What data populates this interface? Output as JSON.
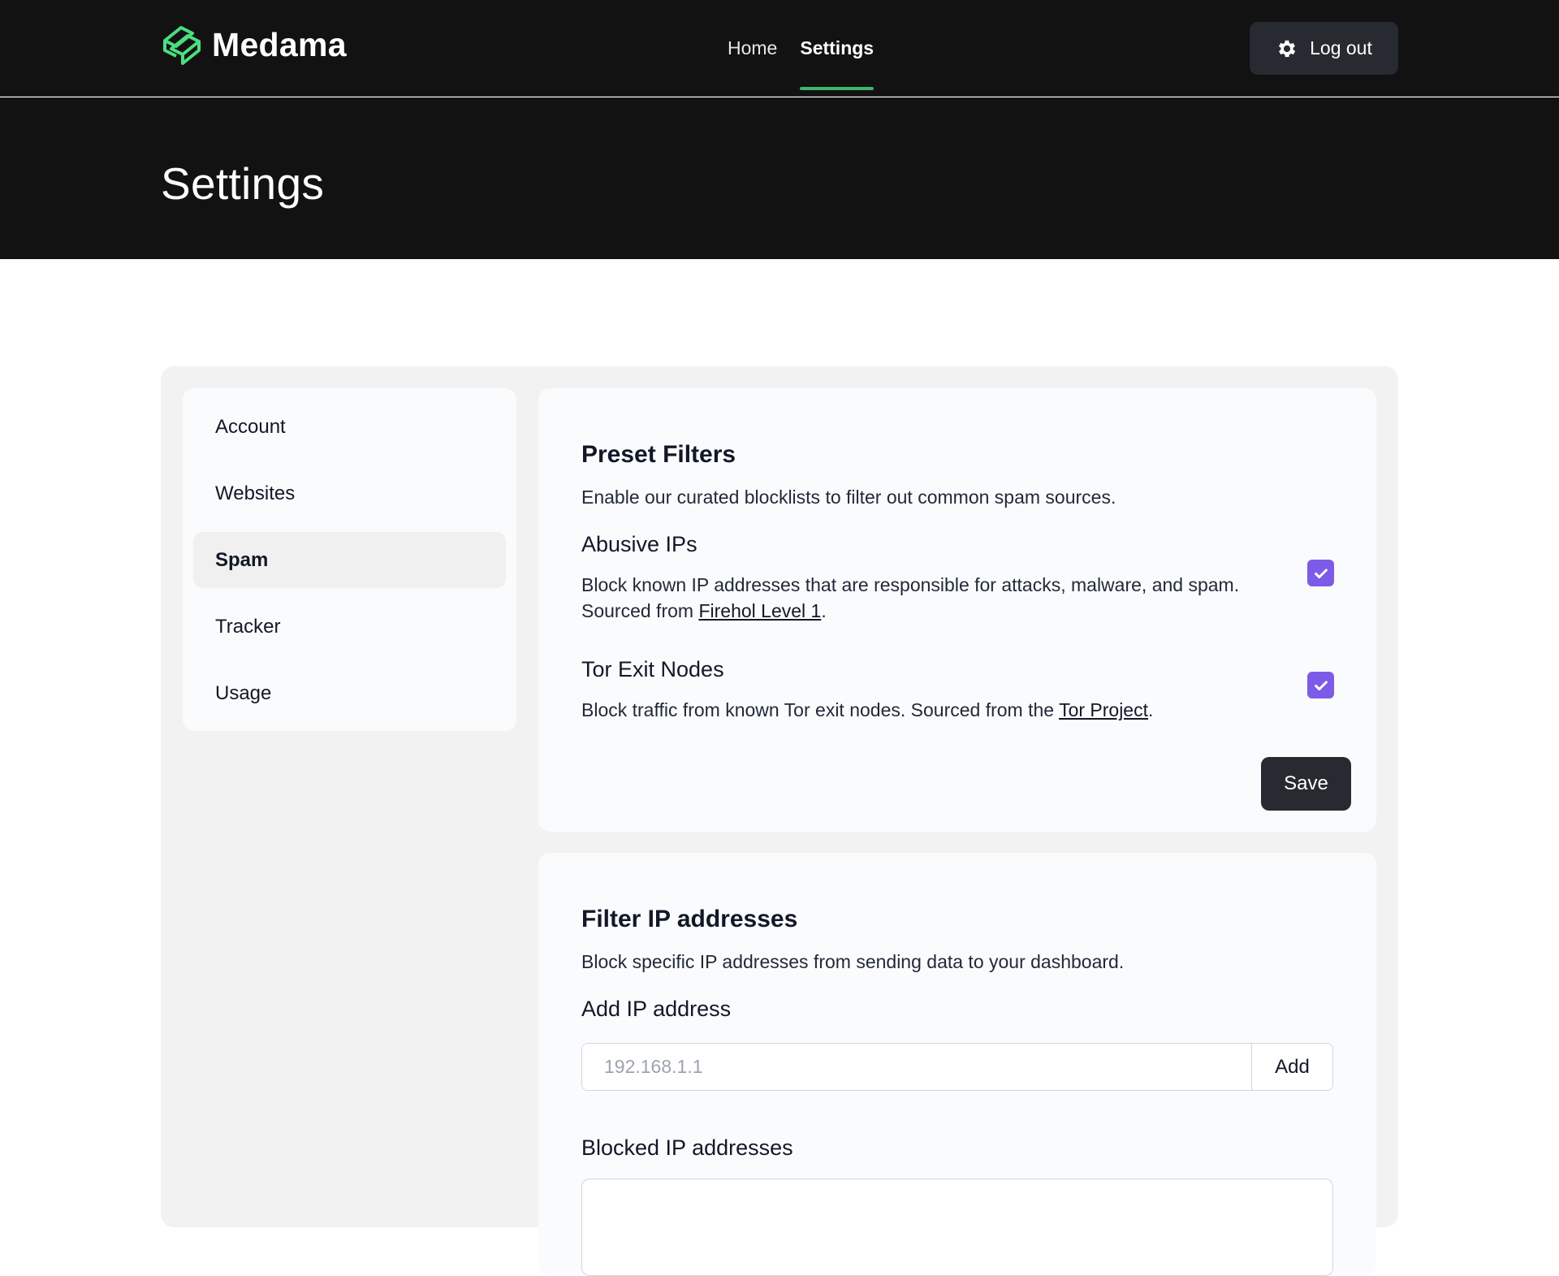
{
  "app": {
    "name": "Medama",
    "accent_color": "#4ade80",
    "checkbox_color": "#7c5ce7"
  },
  "nav": {
    "items": [
      {
        "label": "Home",
        "active": false
      },
      {
        "label": "Settings",
        "active": true
      }
    ],
    "logout": {
      "label": "Log out",
      "icon": "gear-icon"
    }
  },
  "header": {
    "title": "Settings"
  },
  "sidebar": {
    "items": [
      {
        "label": "Account",
        "active": false
      },
      {
        "label": "Websites",
        "active": false
      },
      {
        "label": "Spam",
        "active": true
      },
      {
        "label": "Tracker",
        "active": false
      },
      {
        "label": "Usage",
        "active": false
      }
    ]
  },
  "preset_filters": {
    "title": "Preset Filters",
    "description": "Enable our curated blocklists to filter out common spam sources.",
    "abusive_ips": {
      "title": "Abusive IPs",
      "description_line1": "Block known IP addresses that are responsible for attacks, malware, and spam.",
      "description_prefix": "Sourced from ",
      "link": "Firehol Level 1",
      "description_suffix": ".",
      "checked": true
    },
    "tor_exit_nodes": {
      "title": "Tor Exit Nodes",
      "description_prefix": "Block traffic from known Tor exit nodes. Sourced from the ",
      "link": "Tor Project",
      "description_suffix": ".",
      "checked": true
    },
    "save_label": "Save"
  },
  "filter_ips": {
    "title": "Filter IP addresses",
    "description": "Block specific IP addresses from sending data to your dashboard.",
    "add_label": "Add IP address",
    "input_value": "",
    "input_placeholder": "192.168.1.1",
    "add_button": "Add",
    "blocked_label": "Blocked IP addresses"
  }
}
